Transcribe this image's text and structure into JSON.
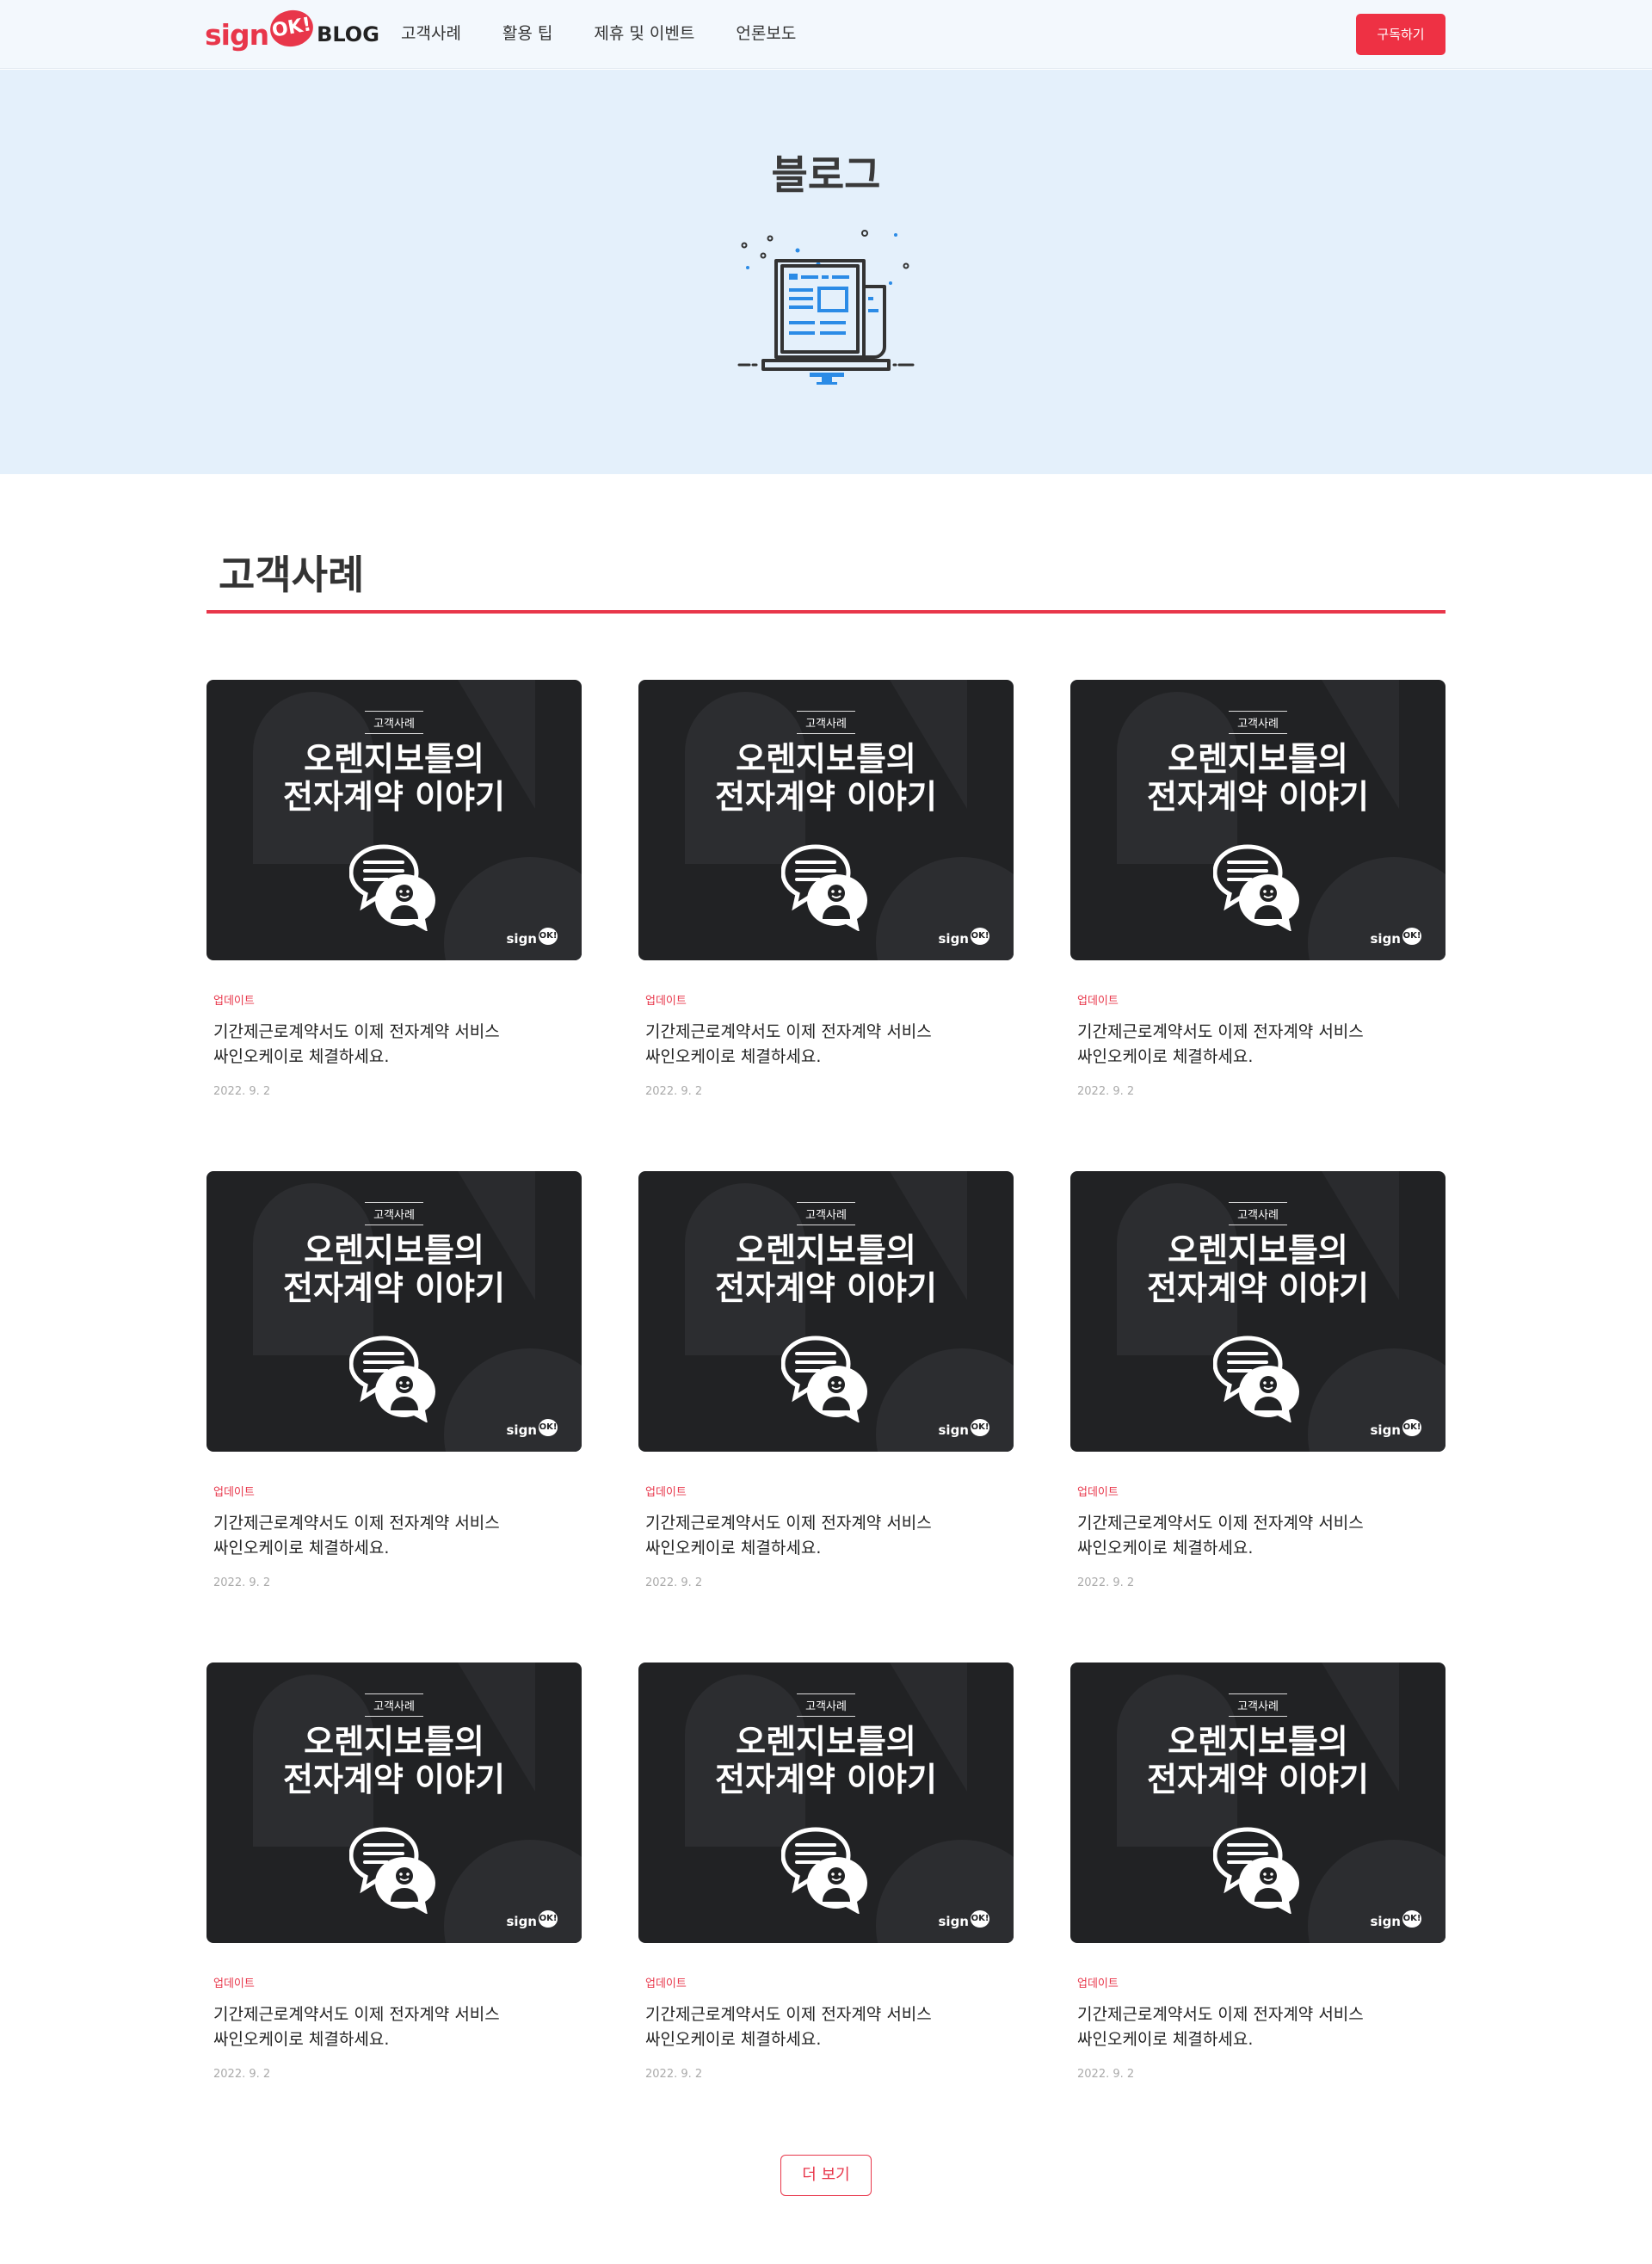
{
  "header": {
    "logo_sign": "sign",
    "logo_ok": "OK!",
    "logo_blog": "BLOG",
    "nav": [
      "고객사례",
      "활용 팁",
      "제휴 및 이벤트",
      "언론보도"
    ],
    "subscribe_label": "구독하기"
  },
  "hero": {
    "title": "블로그"
  },
  "section": {
    "title": "고객사례"
  },
  "colors": {
    "accent": "#e8364a",
    "hero_bg": "#e4f0fb",
    "thumb_bg": "#212224"
  },
  "cards": [
    {
      "thumb_tag": "고객사례",
      "thumb_line1": "오렌지보틀의",
      "thumb_line2": "전자계약 이야기",
      "thumb_logo": "sign",
      "thumb_logo_ok": "OK!",
      "category": "업데이트",
      "title_line1": "기간제근로계약서도 이제 전자계약 서비스",
      "title_line2": "싸인오케이로 체결하세요.",
      "date": "2022. 9. 2"
    },
    {
      "thumb_tag": "고객사례",
      "thumb_line1": "오렌지보틀의",
      "thumb_line2": "전자계약 이야기",
      "thumb_logo": "sign",
      "thumb_logo_ok": "OK!",
      "category": "업데이트",
      "title_line1": "기간제근로계약서도 이제 전자계약 서비스",
      "title_line2": "싸인오케이로 체결하세요.",
      "date": "2022. 9. 2"
    },
    {
      "thumb_tag": "고객사례",
      "thumb_line1": "오렌지보틀의",
      "thumb_line2": "전자계약 이야기",
      "thumb_logo": "sign",
      "thumb_logo_ok": "OK!",
      "category": "업데이트",
      "title_line1": "기간제근로계약서도 이제 전자계약 서비스",
      "title_line2": "싸인오케이로 체결하세요.",
      "date": "2022. 9. 2"
    },
    {
      "thumb_tag": "고객사례",
      "thumb_line1": "오렌지보틀의",
      "thumb_line2": "전자계약 이야기",
      "thumb_logo": "sign",
      "thumb_logo_ok": "OK!",
      "category": "업데이트",
      "title_line1": "기간제근로계약서도 이제 전자계약 서비스",
      "title_line2": "싸인오케이로 체결하세요.",
      "date": "2022. 9. 2"
    },
    {
      "thumb_tag": "고객사례",
      "thumb_line1": "오렌지보틀의",
      "thumb_line2": "전자계약 이야기",
      "thumb_logo": "sign",
      "thumb_logo_ok": "OK!",
      "category": "업데이트",
      "title_line1": "기간제근로계약서도 이제 전자계약 서비스",
      "title_line2": "싸인오케이로 체결하세요.",
      "date": "2022. 9. 2"
    },
    {
      "thumb_tag": "고객사례",
      "thumb_line1": "오렌지보틀의",
      "thumb_line2": "전자계약 이야기",
      "thumb_logo": "sign",
      "thumb_logo_ok": "OK!",
      "category": "업데이트",
      "title_line1": "기간제근로계약서도 이제 전자계약 서비스",
      "title_line2": "싸인오케이로 체결하세요.",
      "date": "2022. 9. 2"
    },
    {
      "thumb_tag": "고객사례",
      "thumb_line1": "오렌지보틀의",
      "thumb_line2": "전자계약 이야기",
      "thumb_logo": "sign",
      "thumb_logo_ok": "OK!",
      "category": "업데이트",
      "title_line1": "기간제근로계약서도 이제 전자계약 서비스",
      "title_line2": "싸인오케이로 체결하세요.",
      "date": "2022. 9. 2"
    },
    {
      "thumb_tag": "고객사례",
      "thumb_line1": "오렌지보틀의",
      "thumb_line2": "전자계약 이야기",
      "thumb_logo": "sign",
      "thumb_logo_ok": "OK!",
      "category": "업데이트",
      "title_line1": "기간제근로계약서도 이제 전자계약 서비스",
      "title_line2": "싸인오케이로 체결하세요.",
      "date": "2022. 9. 2"
    },
    {
      "thumb_tag": "고객사례",
      "thumb_line1": "오렌지보틀의",
      "thumb_line2": "전자계약 이야기",
      "thumb_logo": "sign",
      "thumb_logo_ok": "OK!",
      "category": "업데이트",
      "title_line1": "기간제근로계약서도 이제 전자계약 서비스",
      "title_line2": "싸인오케이로 체결하세요.",
      "date": "2022. 9. 2"
    }
  ],
  "more_label": "더 보기"
}
